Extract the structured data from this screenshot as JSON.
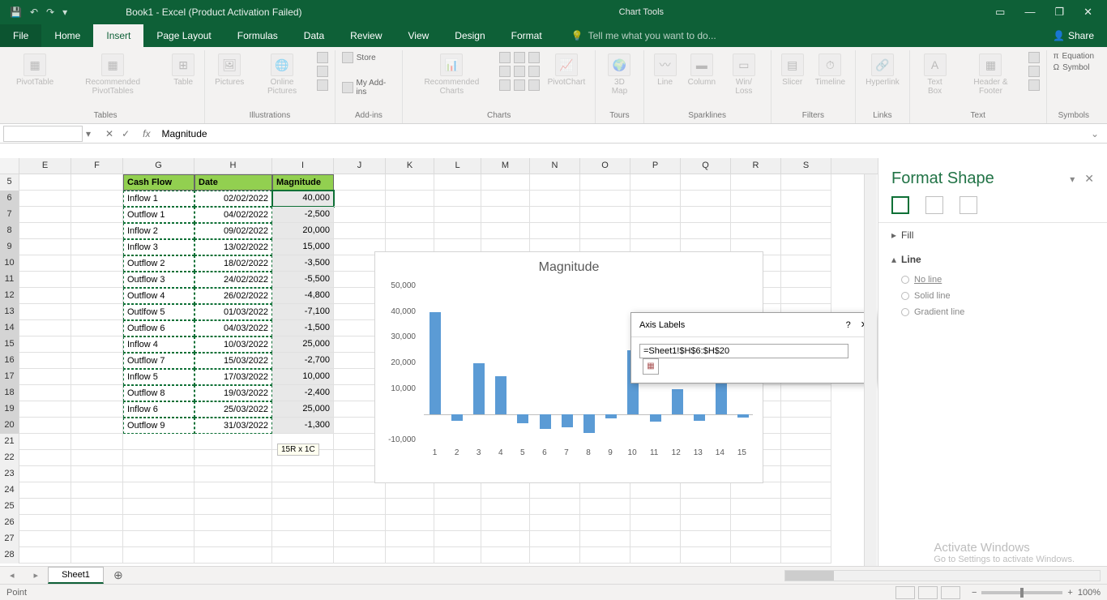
{
  "titlebar": {
    "title": "Book1 - Excel (Product Activation Failed)",
    "chart_tools": "Chart Tools"
  },
  "tabs": {
    "file": "File",
    "home": "Home",
    "insert": "Insert",
    "pagelayout": "Page Layout",
    "formulas": "Formulas",
    "data": "Data",
    "review": "Review",
    "view": "View",
    "design": "Design",
    "format": "Format",
    "tellme": "Tell me what you want to do...",
    "share": "Share"
  },
  "ribbon": {
    "groups": {
      "tables": "Tables",
      "illustrations": "Illustrations",
      "addins": "Add-ins",
      "charts": "Charts",
      "tours": "Tours",
      "sparklines": "Sparklines",
      "filters": "Filters",
      "links": "Links",
      "text": "Text",
      "symbols": "Symbols"
    },
    "buttons": {
      "pivottable": "PivotTable",
      "recpivot": "Recommended\nPivotTables",
      "table": "Table",
      "pictures": "Pictures",
      "onlinepics": "Online\nPictures",
      "store": "Store",
      "myaddins": "My Add-ins",
      "reccharts": "Recommended\nCharts",
      "pivotchart": "PivotChart",
      "map3d": "3D\nMap",
      "line": "Line",
      "column": "Column",
      "winloss": "Win/\nLoss",
      "slicer": "Slicer",
      "timeline": "Timeline",
      "hyperlink": "Hyperlink",
      "textbox": "Text\nBox",
      "headerfooter": "Header\n& Footer",
      "equation": "Equation",
      "symbol": "Symbol"
    }
  },
  "formula_bar": {
    "namebox": "",
    "formula": "Magnitude"
  },
  "columns": [
    "E",
    "F",
    "G",
    "H",
    "I",
    "J",
    "K",
    "L",
    "M",
    "N",
    "O",
    "P",
    "Q",
    "R",
    "S"
  ],
  "row_start": 5,
  "headers": {
    "g": "Cash Flow",
    "h": "Date",
    "i": "Magnitude"
  },
  "table": [
    {
      "g": "Inflow 1",
      "h": "02/02/2022",
      "i": "40,000"
    },
    {
      "g": "Outflow 1",
      "h": "04/02/2022",
      "i": "-2,500"
    },
    {
      "g": "Inflow 2",
      "h": "09/02/2022",
      "i": "20,000"
    },
    {
      "g": "Inflow 3",
      "h": "13/02/2022",
      "i": "15,000"
    },
    {
      "g": "Outflow 2",
      "h": "18/02/2022",
      "i": "-3,500"
    },
    {
      "g": "Outflow 3",
      "h": "24/02/2022",
      "i": "-5,500"
    },
    {
      "g": "Outflow 4",
      "h": "26/02/2022",
      "i": "-4,800"
    },
    {
      "g": "Outlfow 5",
      "h": "01/03/2022",
      "i": "-7,100"
    },
    {
      "g": "Outflow 6",
      "h": "04/03/2022",
      "i": "-1,500"
    },
    {
      "g": "Inflow 4",
      "h": "10/03/2022",
      "i": "25,000"
    },
    {
      "g": "Outflow 7",
      "h": "15/03/2022",
      "i": "-2,700"
    },
    {
      "g": "Inflow 5",
      "h": "17/03/2022",
      "i": "10,000"
    },
    {
      "g": "Outflow 8",
      "h": "19/03/2022",
      "i": "-2,400"
    },
    {
      "g": "Inflow 6",
      "h": "25/03/2022",
      "i": "25,000"
    },
    {
      "g": "Outflow 9",
      "h": "31/03/2022",
      "i": "-1,300"
    }
  ],
  "sel_tip": "15R x 1C",
  "dialog": {
    "title": "Axis Labels",
    "value": "=Sheet1!$H$6:$H$20"
  },
  "task_pane": {
    "title": "Format Shape",
    "sections": {
      "fill": "Fill",
      "line": "Line"
    },
    "line_opts": {
      "none": "No line",
      "solid": "Solid line",
      "grad": "Gradient line"
    }
  },
  "sheet_tab": "Sheet1",
  "status": {
    "mode": "Point",
    "zoom": "100%"
  },
  "activate": {
    "t1": "Activate Windows",
    "t2": "Go to Settings to activate Windows."
  },
  "chart_data": {
    "type": "bar",
    "title": "Magnitude",
    "categories": [
      "1",
      "2",
      "3",
      "4",
      "5",
      "6",
      "7",
      "8",
      "9",
      "10",
      "11",
      "12",
      "13",
      "14",
      "15"
    ],
    "values": [
      40000,
      -2500,
      20000,
      15000,
      -3500,
      -5500,
      -4800,
      -7100,
      -1500,
      25000,
      -2700,
      10000,
      -2400,
      25000,
      -1300
    ],
    "ylim": [
      -10000,
      50000
    ],
    "yticks": [
      -10000,
      0,
      10000,
      20000,
      30000,
      40000,
      50000
    ],
    "ytick_labels": [
      "-10,000",
      "",
      "10,000",
      "20,000",
      "30,000",
      "40,000",
      "50,000"
    ],
    "xlabel": "",
    "ylabel": ""
  }
}
